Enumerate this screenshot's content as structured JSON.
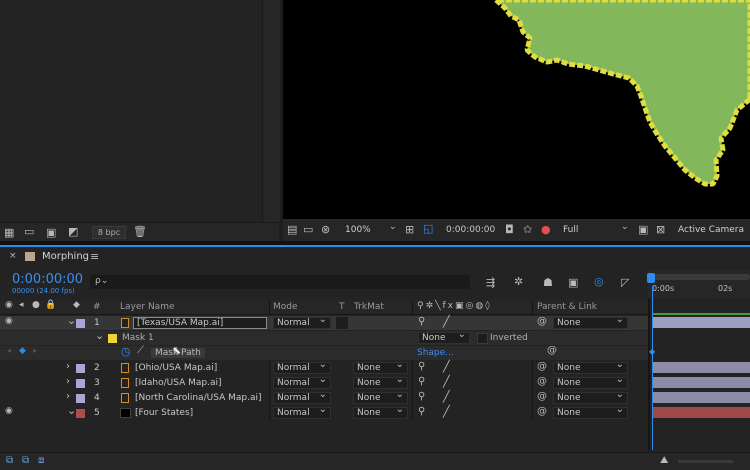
{
  "project": {
    "bpc": "8 bpc",
    "icons": [
      "interpret-footage-icon",
      "new-folder-icon",
      "new-composition-icon",
      "color-swatch-icon"
    ]
  },
  "viewer": {
    "zoom": "100%",
    "timecode": "0:00:00:00",
    "resolution": "Full",
    "camera": "Active Camera"
  },
  "timeline": {
    "comp_name": "Morphing",
    "timecode": "0:00:00:00",
    "frames": "00000 (24.00 fps)",
    "search_placeholder": "ρ⌄",
    "headers": {
      "layer_name": "Layer Name",
      "mode": "Mode",
      "t": "T",
      "trkmat": "TrkMat",
      "parent": "Parent & Link",
      "num": "#"
    },
    "ruler": {
      "start": "0:00s",
      "mark": "02s"
    },
    "mask": {
      "name": "Mask 1",
      "mode": "None",
      "inverted": "Inverted",
      "path_label": "Mask Path",
      "path_value": "Shape..."
    },
    "layers": [
      {
        "num": "1",
        "name": "[Texas/USA Map.ai]",
        "mode": "Normal",
        "trkmat": "",
        "parent": "None",
        "color": "#a9a5d6"
      },
      {
        "num": "2",
        "name": "[Ohio/USA Map.ai]",
        "mode": "Normal",
        "trkmat": "None",
        "parent": "None",
        "color": "#a9a5d6"
      },
      {
        "num": "3",
        "name": "[Idaho/USA Map.ai]",
        "mode": "Normal",
        "trkmat": "None",
        "parent": "None",
        "color": "#a9a5d6"
      },
      {
        "num": "4",
        "name": "[North Carolina/USA Map.ai]",
        "mode": "Normal",
        "trkmat": "None",
        "parent": "None",
        "color": "#a9a5d6"
      },
      {
        "num": "5",
        "name": "[Four States]",
        "mode": "Normal",
        "trkmat": "None",
        "parent": "None",
        "color": "#b34a4a"
      }
    ],
    "footer": {
      "toggle_label": "Toggle Switches / Modes"
    },
    "colors": {
      "accent": "#2d8ceb",
      "map_fill": "#82b85b",
      "map_stroke": "#e2dd3f"
    }
  }
}
